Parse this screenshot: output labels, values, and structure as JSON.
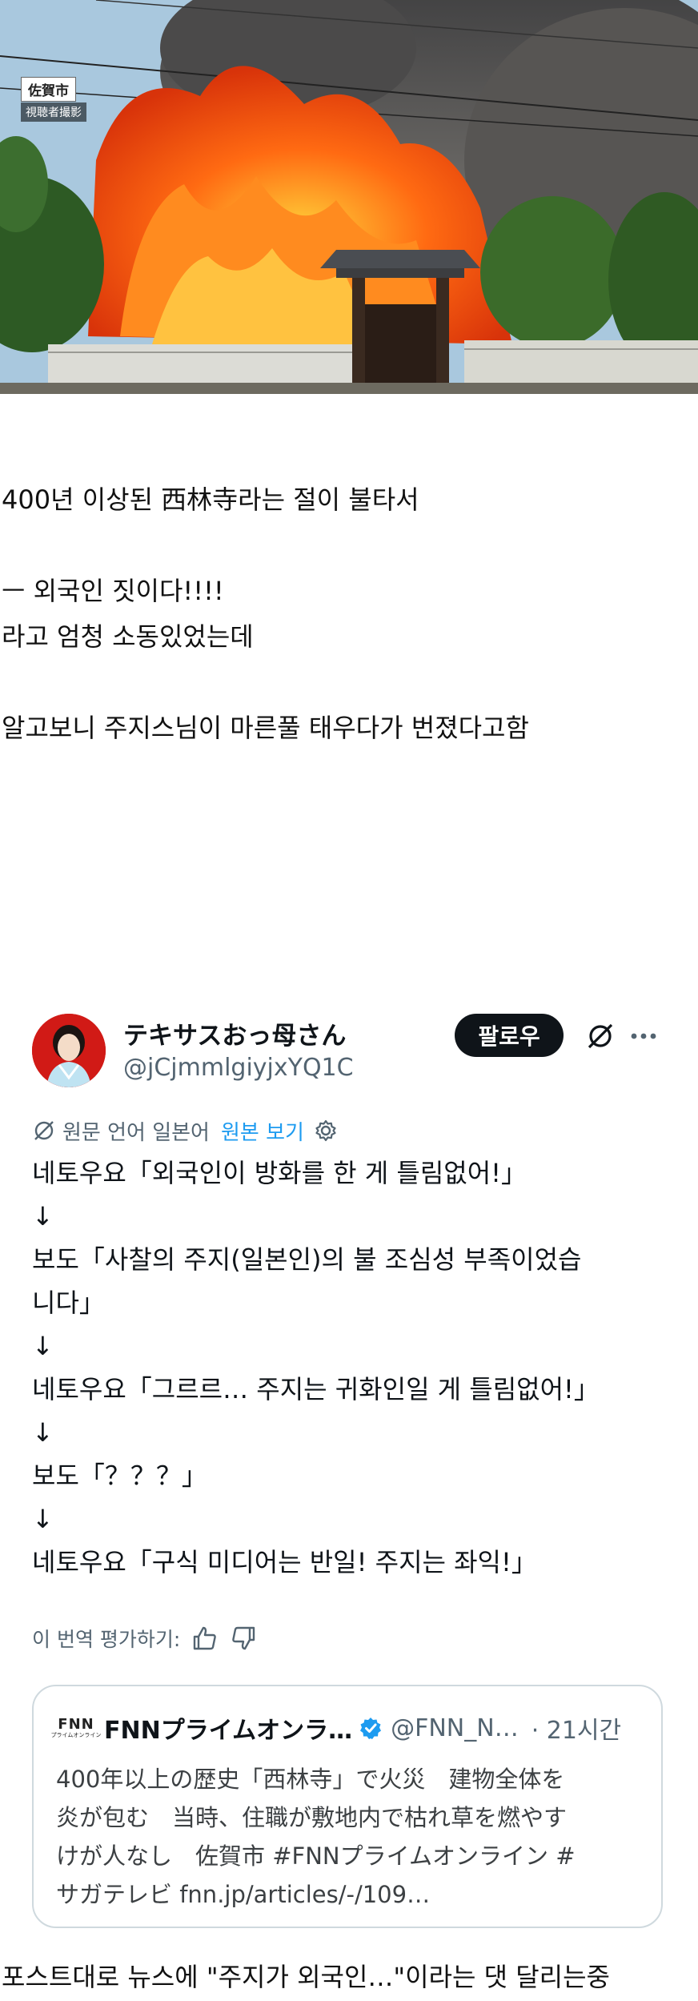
{
  "photo": {
    "location_tag": "佐賀市",
    "credit_tag": "視聴者撮影"
  },
  "post": {
    "lines": [
      "400년 이상된 西林寺라는 절이 불타서",
      "",
      "ㅡ 외국인 짓이다!!!!",
      "라고 엄청 소동있었는데",
      "",
      "알고보니 주지스님이 마른풀 태우다가 번졌다고함"
    ]
  },
  "tweet": {
    "display_name": "テキサスおっ母さん",
    "handle": "@jCjmmlgiyjxYQ1C",
    "follow_label": "팔로우",
    "translated_from": "원문 언어 일본어",
    "show_original": "원본 보기",
    "body_lines": [
      "네토우요「외국인이 방화를 한 게 틀림없어!」",
      "↓",
      "보도「사찰의 주지(일본인)의 불 조심성 부족이었습",
      "니다」",
      "↓",
      "네토우요「그르르… 주지는 귀화인일 게 틀림없어!」",
      "↓",
      "보도「？？？」",
      "↓",
      "네토우요「구식 미디어는 반일! 주지는 좌익!」"
    ],
    "rate_label": "이 번역 평가하기:",
    "quote": {
      "logo_text": "FNN",
      "logo_subtext": "プライムオンライン",
      "name": "FNNプライムオンラ…",
      "handle": "@FNN_N…",
      "time": "· 21시간",
      "body_lines": [
        "400年以上の歴史「西林寺」で火災　建物全体を",
        "炎が包む　当時、住職が敷地内で枯れ草を燃やす",
        "けが人なし　佐賀市 #FNNプライムオンライン #",
        "サガテレビ fnn.jp/articles/-/109…"
      ]
    }
  },
  "caption": "포스트대로 뉴스에 \"주지가 외국인…\"이라는 댓 달리는중",
  "colors": {
    "accent": "#1d9bf0",
    "text_secondary": "#536471",
    "follow_bg": "#0f1419",
    "border": "#cfd9de"
  },
  "icons": [
    "grok-icon",
    "more-icon",
    "translate-icon",
    "gear-icon",
    "thumbs-up-icon",
    "thumbs-down-icon",
    "verified-badge-icon"
  ]
}
